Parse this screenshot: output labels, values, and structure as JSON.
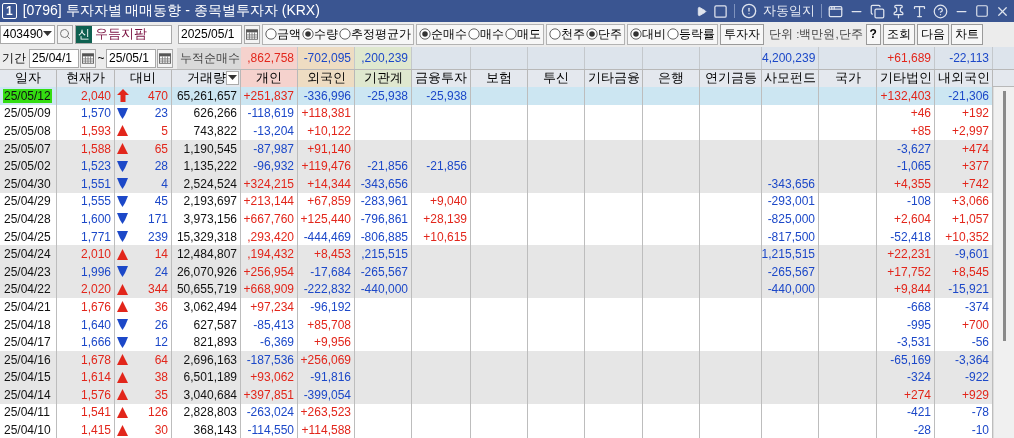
{
  "window": {
    "badge": "1",
    "title": "[0796] 투자자별 매매동향 - 종목별투자자 (KRX)",
    "auto_log": "자동일지"
  },
  "toolbar": {
    "code": "403490",
    "stock_tag": "신",
    "stock_name": "우듬지팜",
    "date": "2025/05/1",
    "option_groups": [
      [
        {
          "label": "금액",
          "selected": false
        },
        {
          "label": "수량",
          "selected": true
        },
        {
          "label": "추정평균가",
          "selected": false
        }
      ],
      [
        {
          "label": "순매수",
          "selected": true
        },
        {
          "label": "매수",
          "selected": false
        },
        {
          "label": "매도",
          "selected": false
        }
      ],
      [
        {
          "label": "천주",
          "selected": false
        },
        {
          "label": "단주",
          "selected": true
        }
      ],
      [
        {
          "label": "대비",
          "selected": true
        },
        {
          "label": "등락률",
          "selected": false
        }
      ]
    ],
    "investor_button": "투자자",
    "unit": "단위 :백만원,단주",
    "help_button": "?",
    "buttons": [
      "조회",
      "다음",
      "차트"
    ]
  },
  "period": {
    "label": "기간",
    "from": "25/04/1",
    "separator": "~",
    "to": "25/05/1",
    "summary_label": "누적순매수",
    "summary": {
      "individual": {
        "text": ",862,758",
        "rise": true
      },
      "foreign": {
        "text": "-702,095",
        "rise": false
      },
      "institution": {
        "text": ",200,239",
        "rise": false
      },
      "private_fund": {
        "text": "4,200,239",
        "rise": false
      },
      "other_corporation": {
        "text": "+61,689",
        "rise": true
      },
      "domestic_foreign": {
        "text": "-22,113",
        "rise": false
      }
    }
  },
  "columns": [
    {
      "label": "일자"
    },
    {
      "label": "현재가"
    },
    {
      "label": "대비"
    },
    {
      "label": "거래량",
      "dropdown": true
    },
    {
      "label": "개인",
      "color": "#f5d2cd"
    },
    {
      "label": "외국인",
      "color": "#eedcc2"
    },
    {
      "label": "기관계",
      "color": "#dfe8cf"
    },
    {
      "label": "금융투자"
    },
    {
      "label": "보험"
    },
    {
      "label": "투신"
    },
    {
      "label": "기타금융"
    },
    {
      "label": "은행"
    },
    {
      "label": "연기금등"
    },
    {
      "label": "사모펀드"
    },
    {
      "label": "국가"
    },
    {
      "label": "기타법인"
    },
    {
      "label": "내외국인"
    }
  ],
  "rows": [
    {
      "date": "25/05/12",
      "selected": true,
      "price": "2,040",
      "kind": "limit_up",
      "change": "470",
      "volume": "65,261,657",
      "investors": {
        "individual": {
          "text": "+251,837",
          "rise": true
        },
        "foreign": {
          "text": "-336,996",
          "rise": false
        },
        "institution": {
          "text": "-25,938",
          "rise": false
        },
        "financial_investment": {
          "text": "-25,938",
          "rise": false
        },
        "other_corporation": {
          "text": "+132,403",
          "rise": true
        },
        "domestic_foreign": {
          "text": "-21,306",
          "rise": false
        }
      }
    },
    {
      "date": "25/05/09",
      "selected": false,
      "price": "1,570",
      "kind": "down",
      "change": "23",
      "volume": "626,266",
      "investors": {
        "individual": {
          "text": "-118,619",
          "rise": false
        },
        "foreign": {
          "text": "+118,381",
          "rise": true
        },
        "other_corporation": {
          "text": "+46",
          "rise": true
        },
        "domestic_foreign": {
          "text": "+192",
          "rise": true
        }
      }
    },
    {
      "date": "25/05/08",
      "selected": false,
      "price": "1,593",
      "kind": "up",
      "change": "5",
      "volume": "743,822",
      "investors": {
        "individual": {
          "text": "-13,204",
          "rise": false
        },
        "foreign": {
          "text": "+10,122",
          "rise": true
        },
        "other_corporation": {
          "text": "+85",
          "rise": true
        },
        "domestic_foreign": {
          "text": "+2,997",
          "rise": true
        }
      }
    },
    {
      "date": "25/05/07",
      "selected": false,
      "price": "1,588",
      "kind": "up",
      "change": "65",
      "volume": "1,190,545",
      "investors": {
        "individual": {
          "text": "-87,987",
          "rise": false
        },
        "foreign": {
          "text": "+91,140",
          "rise": true
        },
        "other_corporation": {
          "text": "-3,627",
          "rise": false
        },
        "domestic_foreign": {
          "text": "+474",
          "rise": true
        }
      }
    },
    {
      "date": "25/05/02",
      "selected": false,
      "price": "1,523",
      "kind": "down",
      "change": "28",
      "volume": "1,135,222",
      "investors": {
        "individual": {
          "text": "-96,932",
          "rise": false
        },
        "foreign": {
          "text": "+119,476",
          "rise": true
        },
        "institution": {
          "text": "-21,856",
          "rise": false
        },
        "financial_investment": {
          "text": "-21,856",
          "rise": false
        },
        "other_corporation": {
          "text": "-1,065",
          "rise": false
        },
        "domestic_foreign": {
          "text": "+377",
          "rise": true
        }
      }
    },
    {
      "date": "25/04/30",
      "selected": false,
      "price": "1,551",
      "kind": "down",
      "change": "4",
      "volume": "2,524,524",
      "investors": {
        "individual": {
          "text": "+324,215",
          "rise": true
        },
        "foreign": {
          "text": "+14,344",
          "rise": true
        },
        "institution": {
          "text": "-343,656",
          "rise": false
        },
        "private_fund": {
          "text": "-343,656",
          "rise": false
        },
        "other_corporation": {
          "text": "+4,355",
          "rise": true
        },
        "domestic_foreign": {
          "text": "+742",
          "rise": true
        }
      }
    },
    {
      "date": "25/04/29",
      "selected": false,
      "price": "1,555",
      "kind": "down",
      "change": "45",
      "volume": "2,193,697",
      "investors": {
        "individual": {
          "text": "+213,144",
          "rise": true
        },
        "foreign": {
          "text": "+67,859",
          "rise": true
        },
        "institution": {
          "text": "-283,961",
          "rise": false
        },
        "financial_investment": {
          "text": "+9,040",
          "rise": true
        },
        "private_fund": {
          "text": "-293,001",
          "rise": false
        },
        "other_corporation": {
          "text": "-108",
          "rise": false
        },
        "domestic_foreign": {
          "text": "+3,066",
          "rise": true
        }
      }
    },
    {
      "date": "25/04/28",
      "selected": false,
      "price": "1,600",
      "kind": "down",
      "change": "171",
      "volume": "3,973,156",
      "investors": {
        "individual": {
          "text": "+667,760",
          "rise": true
        },
        "foreign": {
          "text": "+125,440",
          "rise": true
        },
        "institution": {
          "text": "-796,861",
          "rise": false
        },
        "financial_investment": {
          "text": "+28,139",
          "rise": true
        },
        "private_fund": {
          "text": "-825,000",
          "rise": false
        },
        "other_corporation": {
          "text": "+2,604",
          "rise": true
        },
        "domestic_foreign": {
          "text": "+1,057",
          "rise": true
        }
      }
    },
    {
      "date": "25/04/25",
      "selected": false,
      "price": "1,771",
      "kind": "down",
      "change": "239",
      "volume": "15,329,318",
      "investors": {
        "individual": {
          "text": ",293,420",
          "rise": true
        },
        "foreign": {
          "text": "-444,469",
          "rise": false
        },
        "institution": {
          "text": "-806,885",
          "rise": false
        },
        "financial_investment": {
          "text": "+10,615",
          "rise": true
        },
        "private_fund": {
          "text": "-817,500",
          "rise": false
        },
        "other_corporation": {
          "text": "-52,418",
          "rise": false
        },
        "domestic_foreign": {
          "text": "+10,352",
          "rise": true
        }
      }
    },
    {
      "date": "25/04/24",
      "selected": false,
      "price": "2,010",
      "kind": "up",
      "change": "14",
      "volume": "12,484,807",
      "investors": {
        "individual": {
          "text": ",194,432",
          "rise": true
        },
        "foreign": {
          "text": "+8,453",
          "rise": true
        },
        "institution": {
          "text": ",215,515",
          "rise": false
        },
        "private_fund": {
          "text": "1,215,515",
          "rise": false
        },
        "other_corporation": {
          "text": "+22,231",
          "rise": true
        },
        "domestic_foreign": {
          "text": "-9,601",
          "rise": false
        }
      }
    },
    {
      "date": "25/04/23",
      "selected": false,
      "price": "1,996",
      "kind": "down",
      "change": "24",
      "volume": "26,070,926",
      "investors": {
        "individual": {
          "text": "+256,954",
          "rise": true
        },
        "foreign": {
          "text": "-17,684",
          "rise": false
        },
        "institution": {
          "text": "-265,567",
          "rise": false
        },
        "private_fund": {
          "text": "-265,567",
          "rise": false
        },
        "other_corporation": {
          "text": "+17,752",
          "rise": true
        },
        "domestic_foreign": {
          "text": "+8,545",
          "rise": true
        }
      }
    },
    {
      "date": "25/04/22",
      "selected": false,
      "price": "2,020",
      "kind": "up",
      "change": "344",
      "volume": "50,655,719",
      "investors": {
        "individual": {
          "text": "+668,909",
          "rise": true
        },
        "foreign": {
          "text": "-222,832",
          "rise": false
        },
        "institution": {
          "text": "-440,000",
          "rise": false
        },
        "private_fund": {
          "text": "-440,000",
          "rise": false
        },
        "other_corporation": {
          "text": "+9,844",
          "rise": true
        },
        "domestic_foreign": {
          "text": "-15,921",
          "rise": false
        }
      }
    },
    {
      "date": "25/04/21",
      "selected": false,
      "price": "1,676",
      "kind": "up",
      "change": "36",
      "volume": "3,062,494",
      "investors": {
        "individual": {
          "text": "+97,234",
          "rise": true
        },
        "foreign": {
          "text": "-96,192",
          "rise": false
        },
        "other_corporation": {
          "text": "-668",
          "rise": false
        },
        "domestic_foreign": {
          "text": "-374",
          "rise": false
        }
      }
    },
    {
      "date": "25/04/18",
      "selected": false,
      "price": "1,640",
      "kind": "down",
      "change": "26",
      "volume": "627,587",
      "investors": {
        "individual": {
          "text": "-85,413",
          "rise": false
        },
        "foreign": {
          "text": "+85,708",
          "rise": true
        },
        "other_corporation": {
          "text": "-995",
          "rise": false
        },
        "domestic_foreign": {
          "text": "+700",
          "rise": true
        }
      }
    },
    {
      "date": "25/04/17",
      "selected": false,
      "price": "1,666",
      "kind": "down",
      "change": "12",
      "volume": "821,893",
      "investors": {
        "individual": {
          "text": "-6,369",
          "rise": false
        },
        "foreign": {
          "text": "+9,956",
          "rise": true
        },
        "other_corporation": {
          "text": "-3,531",
          "rise": false
        },
        "domestic_foreign": {
          "text": "-56",
          "rise": false
        }
      }
    },
    {
      "date": "25/04/16",
      "selected": false,
      "price": "1,678",
      "kind": "up",
      "change": "64",
      "volume": "2,696,163",
      "investors": {
        "individual": {
          "text": "-187,536",
          "rise": false
        },
        "foreign": {
          "text": "+256,069",
          "rise": true
        },
        "other_corporation": {
          "text": "-65,169",
          "rise": false
        },
        "domestic_foreign": {
          "text": "-3,364",
          "rise": false
        }
      }
    },
    {
      "date": "25/04/15",
      "selected": false,
      "price": "1,614",
      "kind": "up",
      "change": "38",
      "volume": "6,501,189",
      "investors": {
        "individual": {
          "text": "+93,062",
          "rise": true
        },
        "foreign": {
          "text": "-91,816",
          "rise": false
        },
        "other_corporation": {
          "text": "-324",
          "rise": false
        },
        "domestic_foreign": {
          "text": "-922",
          "rise": false
        }
      }
    },
    {
      "date": "25/04/14",
      "selected": false,
      "price": "1,576",
      "kind": "up",
      "change": "35",
      "volume": "3,040,684",
      "investors": {
        "individual": {
          "text": "+397,851",
          "rise": true
        },
        "foreign": {
          "text": "-399,054",
          "rise": false
        },
        "other_corporation": {
          "text": "+274",
          "rise": true
        },
        "domestic_foreign": {
          "text": "+929",
          "rise": true
        }
      }
    },
    {
      "date": "25/04/11",
      "selected": false,
      "price": "1,541",
      "kind": "up",
      "change": "126",
      "volume": "2,828,803",
      "investors": {
        "individual": {
          "text": "-263,024",
          "rise": false
        },
        "foreign": {
          "text": "+263,523",
          "rise": true
        },
        "other_corporation": {
          "text": "-421",
          "rise": false
        },
        "domestic_foreign": {
          "text": "-78",
          "rise": false
        }
      }
    },
    {
      "date": "25/04/10",
      "selected": false,
      "price": "1,415",
      "kind": "up",
      "change": "30",
      "volume": "368,143",
      "investors": {
        "individual": {
          "text": "-114,550",
          "rise": false
        },
        "foreign": {
          "text": "+114,588",
          "rise": true
        },
        "other_corporation": {
          "text": "-28",
          "rise": false
        },
        "domestic_foreign": {
          "text": "-10",
          "rise": false
        }
      }
    }
  ]
}
